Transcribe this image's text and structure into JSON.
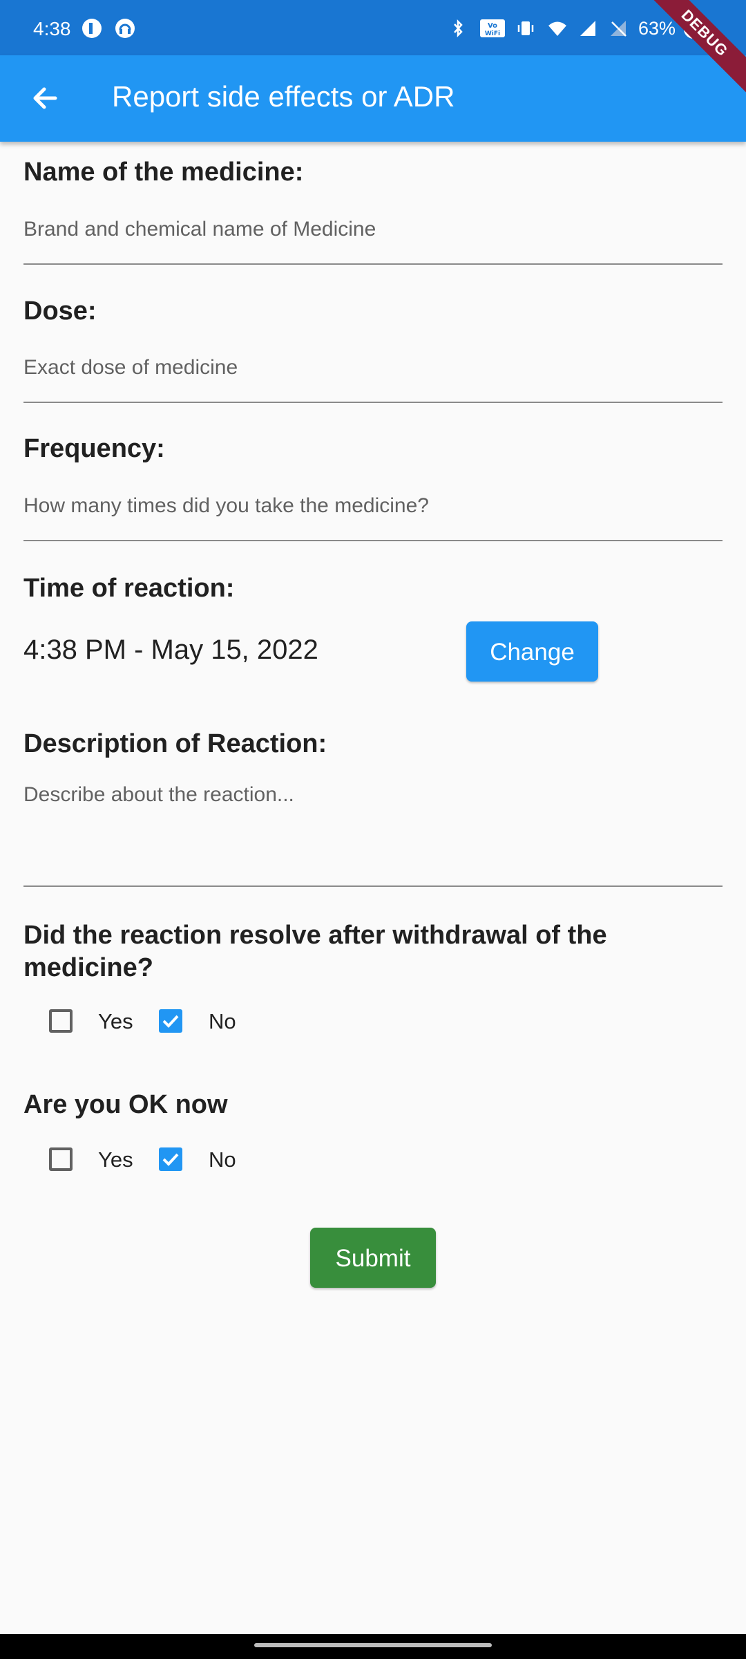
{
  "status_bar": {
    "time": "4:38",
    "battery": "63%",
    "debug_label": "DEBUG"
  },
  "app_bar": {
    "title": "Report side effects or ADR"
  },
  "form": {
    "medicine": {
      "label": "Name of the medicine:",
      "placeholder": "Brand and chemical name of Medicine"
    },
    "dose": {
      "label": "Dose:",
      "placeholder": "Exact dose of medicine"
    },
    "frequency": {
      "label": "Frequency:",
      "placeholder": "How many times did you take the medicine?"
    },
    "time_of_reaction": {
      "label": "Time of reaction:",
      "value": "4:38 PM - May 15, 2022",
      "button_label": "Change"
    },
    "description": {
      "label": "Description of Reaction:",
      "placeholder": "Describe about the reaction..."
    },
    "resolved": {
      "label": "Did the reaction resolve after withdrawal of the medicine?",
      "yes_label": "Yes",
      "no_label": "No",
      "yes_checked": false,
      "no_checked": true
    },
    "ok_now": {
      "label": "Are you OK now",
      "yes_label": "Yes",
      "no_label": "No",
      "yes_checked": false,
      "no_checked": true
    },
    "submit_label": "Submit"
  },
  "colors": {
    "status_bar": "#1976d2",
    "app_bar": "#2196f3",
    "submit": "#388e3c",
    "checkbox_checked": "#2196f3"
  }
}
